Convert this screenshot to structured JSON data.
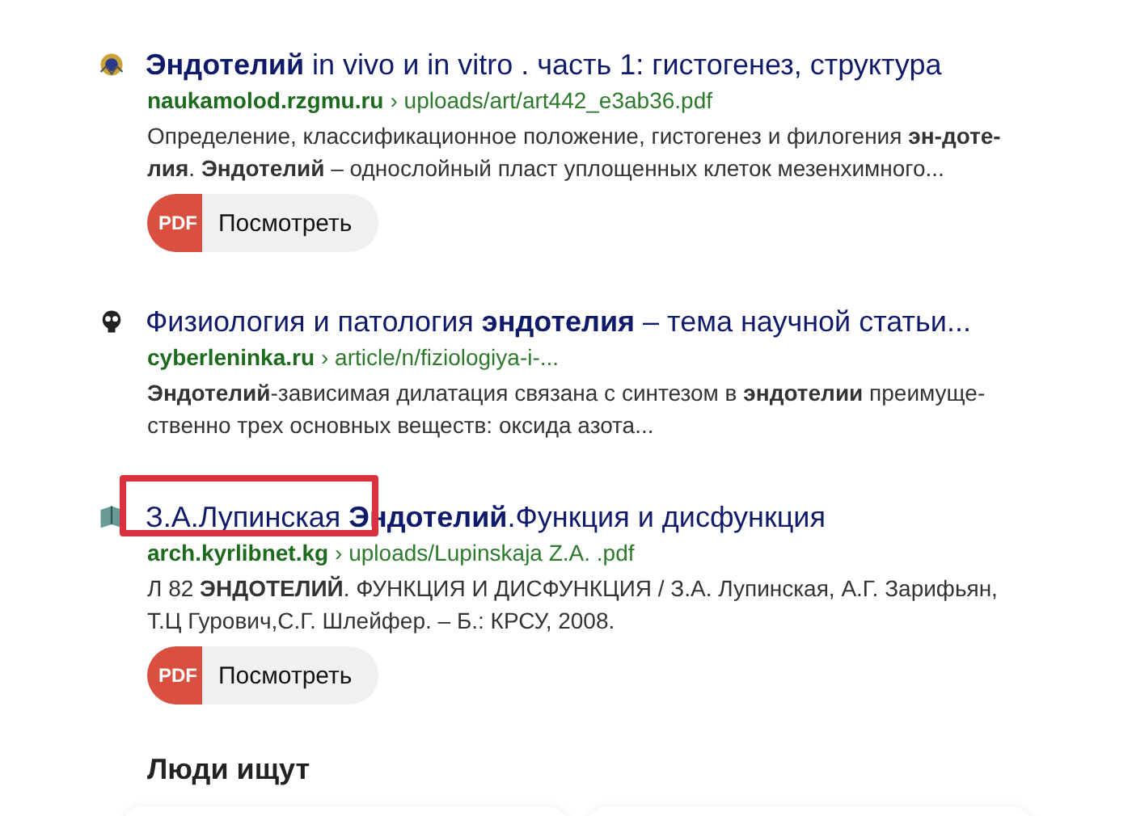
{
  "results": [
    {
      "title": "**Эндотелий** in vivo и in vitro . часть 1: гистогенез, структура",
      "domain": "naukamolod.rzgmu.ru",
      "path": "› uploads/art/art442_e3ab36.pdf",
      "snippet": "Определение, классификационное положение, гистогенез и филогения **эн-доте-лия**. **Эндотелий** – однослойный пласт уплощенных клеток мезенхимного...",
      "highlighted": false,
      "pdf": {
        "badge": "PDF",
        "label": "Посмотреть"
      }
    },
    {
      "title": "Физиология и патология **эндотелия** – тема научной статьи...",
      "domain": "cyberleninka.ru",
      "path": "› article/n/fiziologiya-i-...",
      "snippet": "**Эндотелий**-зависимая дилатация связана с синтезом в **эндотелии** преимуще-ственно трех основных веществ: оксида азота...",
      "highlighted": false
    },
    {
      "title": "З.А.Лупинская **Эндотелий**.Функция и дисфункция",
      "domain": "arch.kyrlibnet.kg",
      "path": "› uploads/Lupinskaja Z.A. .pdf",
      "snippet": "Л 82 **ЭНДОТЕЛИЙ**. ФУНКЦИЯ И ДИСФУНКЦИЯ / З.А. Лупинская, А.Г. Зарифьян, Т.Ц Гурович,С.Г. Шлейфер. – Б.: КРСУ, 2008.",
      "highlighted": true,
      "pdf": {
        "badge": "PDF",
        "label": "Посмотреть"
      }
    }
  ],
  "people_search": {
    "title": "Люди ищут"
  }
}
